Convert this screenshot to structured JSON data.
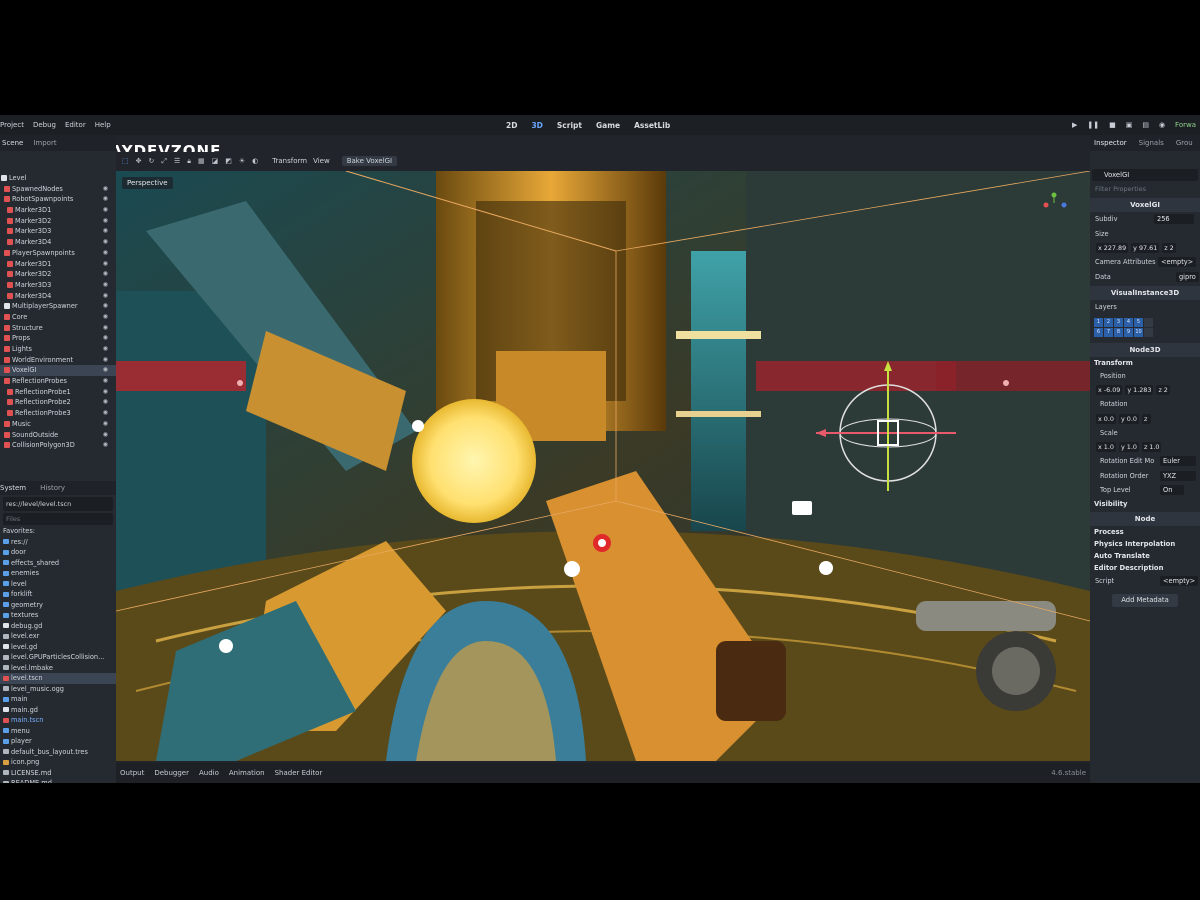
{
  "menubar": {
    "menu_items": [
      "Project",
      "Debug",
      "Editor",
      "Help"
    ],
    "main_tabs": [
      "2D",
      "3D",
      "Script",
      "Game",
      "AssetLib"
    ],
    "active_tab": "3D",
    "renderer": "Forwa"
  },
  "logo": {
    "text": "PLAYDEVZONE"
  },
  "scene_dock": {
    "tabs": [
      "Scene",
      "Import"
    ],
    "tree": [
      {
        "label": "Level",
        "color": "#e0e3e8",
        "indent": 0
      },
      {
        "label": "SpawnedNodes",
        "color": "#e05252",
        "indent": 1
      },
      {
        "label": "RobotSpawnpoints",
        "color": "#e05252",
        "indent": 1
      },
      {
        "label": "Marker3D1",
        "color": "#e05252",
        "indent": 2
      },
      {
        "label": "Marker3D2",
        "color": "#e05252",
        "indent": 2
      },
      {
        "label": "Marker3D3",
        "color": "#e05252",
        "indent": 2
      },
      {
        "label": "Marker3D4",
        "color": "#e05252",
        "indent": 2
      },
      {
        "label": "PlayerSpawnpoints",
        "color": "#e05252",
        "indent": 1
      },
      {
        "label": "Marker3D1",
        "color": "#e05252",
        "indent": 2
      },
      {
        "label": "Marker3D2",
        "color": "#e05252",
        "indent": 2
      },
      {
        "label": "Marker3D3",
        "color": "#e05252",
        "indent": 2
      },
      {
        "label": "Marker3D4",
        "color": "#e05252",
        "indent": 2
      },
      {
        "label": "MultiplayerSpawner",
        "color": "#e0e3e8",
        "indent": 1
      },
      {
        "label": "Core",
        "color": "#e05252",
        "indent": 1
      },
      {
        "label": "Structure",
        "color": "#e05252",
        "indent": 1
      },
      {
        "label": "Props",
        "color": "#e05252",
        "indent": 1
      },
      {
        "label": "Lights",
        "color": "#e05252",
        "indent": 1
      },
      {
        "label": "WorldEnvironment",
        "color": "#e05252",
        "indent": 1
      },
      {
        "label": "VoxelGI",
        "color": "#e05252",
        "indent": 1,
        "selected": true
      },
      {
        "label": "ReflectionProbes",
        "color": "#e05252",
        "indent": 1
      },
      {
        "label": "ReflectionProbe1",
        "color": "#e05252",
        "indent": 2
      },
      {
        "label": "ReflectionProbe2",
        "color": "#e05252",
        "indent": 2
      },
      {
        "label": "ReflectionProbe3",
        "color": "#e05252",
        "indent": 2
      },
      {
        "label": "Music",
        "color": "#e05252",
        "indent": 1
      },
      {
        "label": "SoundOutside",
        "color": "#e05252",
        "indent": 1
      },
      {
        "label": "CollisionPolygon3D",
        "color": "#e05252",
        "indent": 1
      }
    ]
  },
  "filesystem": {
    "tabs": [
      "System",
      "History"
    ],
    "path": "res://level/level.tscn",
    "filter_placeholder": "Files",
    "items": [
      {
        "label": "Favorites:",
        "kind": "header"
      },
      {
        "label": "res://",
        "kind": "folder"
      },
      {
        "label": "door",
        "kind": "folder"
      },
      {
        "label": "effects_shared",
        "kind": "folder"
      },
      {
        "label": "enemies",
        "kind": "folder"
      },
      {
        "label": "level",
        "kind": "folder"
      },
      {
        "label": "forklift",
        "kind": "folder"
      },
      {
        "label": "geometry",
        "kind": "folder"
      },
      {
        "label": "textures",
        "kind": "folder"
      },
      {
        "label": "debug.gd",
        "kind": "script"
      },
      {
        "label": "level.exr",
        "kind": "file"
      },
      {
        "label": "level.gd",
        "kind": "script"
      },
      {
        "label": "level.GPUParticlesCollision...",
        "kind": "file"
      },
      {
        "label": "level.lmbake",
        "kind": "file"
      },
      {
        "label": "level.tscn",
        "kind": "scene",
        "selected": true
      },
      {
        "label": "level_music.ogg",
        "kind": "file"
      },
      {
        "label": "main",
        "kind": "folder"
      },
      {
        "label": "main.gd",
        "kind": "script"
      },
      {
        "label": "main.tscn",
        "kind": "scene"
      },
      {
        "label": "menu",
        "kind": "folder"
      },
      {
        "label": "player",
        "kind": "folder"
      },
      {
        "label": "default_bus_layout.tres",
        "kind": "file"
      },
      {
        "label": "icon.png",
        "kind": "image"
      },
      {
        "label": "LICENSE.md",
        "kind": "file"
      },
      {
        "label": "README.md",
        "kind": "file"
      }
    ]
  },
  "toolbar": {
    "transform_label": "Transform",
    "view_label": "View",
    "bake_label": "Bake VoxelGI"
  },
  "viewport": {
    "perspective_label": "Perspective"
  },
  "bottom_panel": {
    "tabs": [
      "Output",
      "Debugger",
      "Audio",
      "Animation",
      "Shader Editor"
    ],
    "version": "4.6.stable"
  },
  "inspector": {
    "tabs": [
      "Inspector",
      "Signals",
      "Grou"
    ],
    "node_name": "VoxelGI",
    "filter_placeholder": "Filter Properties",
    "voxelgi_section": "VoxelGI",
    "subdiv_label": "Subdiv",
    "subdiv_value": "256",
    "size_label": "Size",
    "size_x": "227.89",
    "size_y": "97.61",
    "size_z": "2",
    "camera_attr_label": "Camera Attributes",
    "camera_attr_value": "<empty>",
    "data_label": "Data",
    "data_value": "gipro",
    "visual_instance_section": "VisualInstance3D",
    "layers_label": "Layers",
    "layers": [
      "1",
      "2",
      "3",
      "4",
      "5",
      "",
      "6",
      "7",
      "8",
      "9",
      "10",
      ""
    ],
    "node3d_section": "Node3D",
    "transform_group": "Transform",
    "position_label": "Position",
    "pos_x": "-6.09",
    "pos_y": "1.283",
    "pos_z": "2",
    "rotation_label": "Rotation",
    "rot_x": "0.0",
    "rot_y": "0.0",
    "rot_z": "",
    "scale_label": "Scale",
    "scale_x": "1.0",
    "scale_y": "1.0",
    "scale_z": "1.0",
    "rot_edit_label": "Rotation Edit Mo",
    "rot_edit_value": "Euler",
    "rot_order_label": "Rotation Order",
    "rot_order_value": "YXZ",
    "top_level_label": "Top Level",
    "top_level_value": "On",
    "visibility_group": "Visibility",
    "node_section": "Node",
    "process_group": "Process",
    "physics_interp_group": "Physics Interpolation",
    "auto_translate_group": "Auto Translate",
    "editor_desc_group": "Editor Description",
    "script_label": "Script",
    "script_value": "<empty>",
    "add_metadata_label": "Add Metadata"
  }
}
